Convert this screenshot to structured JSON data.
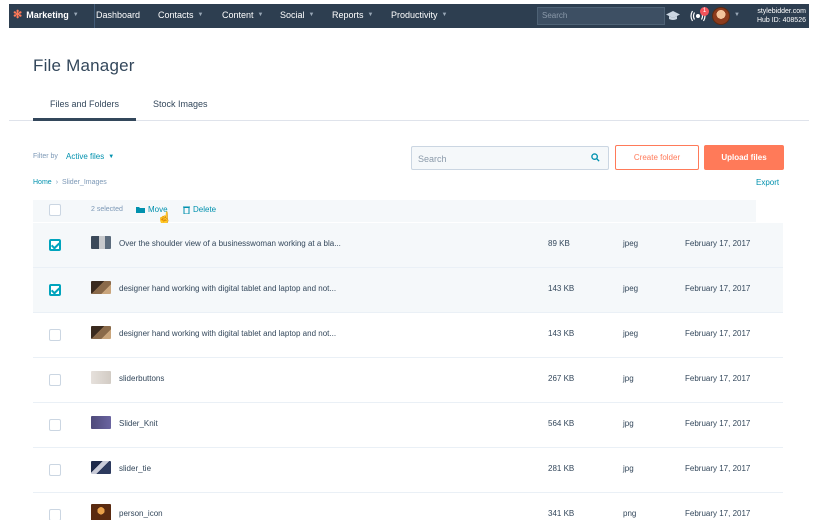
{
  "topnav": {
    "brand": "Marketing",
    "items": [
      {
        "label": "Dashboard",
        "caret": false
      },
      {
        "label": "Contacts",
        "caret": true
      },
      {
        "label": "Content",
        "caret": true
      },
      {
        "label": "Social",
        "caret": true
      },
      {
        "label": "Reports",
        "caret": true
      },
      {
        "label": "Productivity",
        "caret": true
      }
    ],
    "search_placeholder": "Search",
    "notification_count": "1",
    "account_domain": "stylebidder.com",
    "hub_id": "Hub ID: 408526",
    "icons": [
      "hubspot-sprocket-icon",
      "academy-cap-icon",
      "notifications-icon",
      "avatar"
    ]
  },
  "page": {
    "title": "File Manager",
    "tabs": [
      {
        "label": "Files and Folders",
        "active": true
      },
      {
        "label": "Stock Images",
        "active": false
      }
    ]
  },
  "toolbar": {
    "filter_label": "Filter by",
    "filter_value": "Active files",
    "search_placeholder": "Search",
    "create_folder": "Create folder",
    "upload_files": "Upload files",
    "export": "Export"
  },
  "breadcrumb": {
    "home": "Home",
    "separator": "›",
    "current": "Slider_Images"
  },
  "bulk": {
    "selected": "2 selected",
    "move": "Move",
    "delete": "Delete"
  },
  "files": [
    {
      "name": "Over the shoulder view of a businesswoman working at a bla...",
      "size": "89 KB",
      "type": "jpeg",
      "date": "February 17, 2017",
      "checked": true
    },
    {
      "name": "designer hand working with digital tablet and laptop and not...",
      "size": "143 KB",
      "type": "jpeg",
      "date": "February 17, 2017",
      "checked": true
    },
    {
      "name": "designer hand working with digital tablet and laptop and not...",
      "size": "143 KB",
      "type": "jpeg",
      "date": "February 17, 2017",
      "checked": false
    },
    {
      "name": "sliderbuttons",
      "size": "267 KB",
      "type": "jpg",
      "date": "February 17, 2017",
      "checked": false
    },
    {
      "name": "Slider_Knit",
      "size": "564 KB",
      "type": "jpg",
      "date": "February 17, 2017",
      "checked": false
    },
    {
      "name": "slider_tie",
      "size": "281 KB",
      "type": "jpg",
      "date": "February 17, 2017",
      "checked": false
    },
    {
      "name": "person_icon",
      "size": "341 KB",
      "type": "png",
      "date": "February 17, 2017",
      "checked": false
    }
  ],
  "colors": {
    "nav_bg": "#2d3e50",
    "accent_orange": "#ff7a59",
    "link_teal": "#0091ae",
    "checkbox_teal": "#00a4bd",
    "text": "#33475b"
  }
}
